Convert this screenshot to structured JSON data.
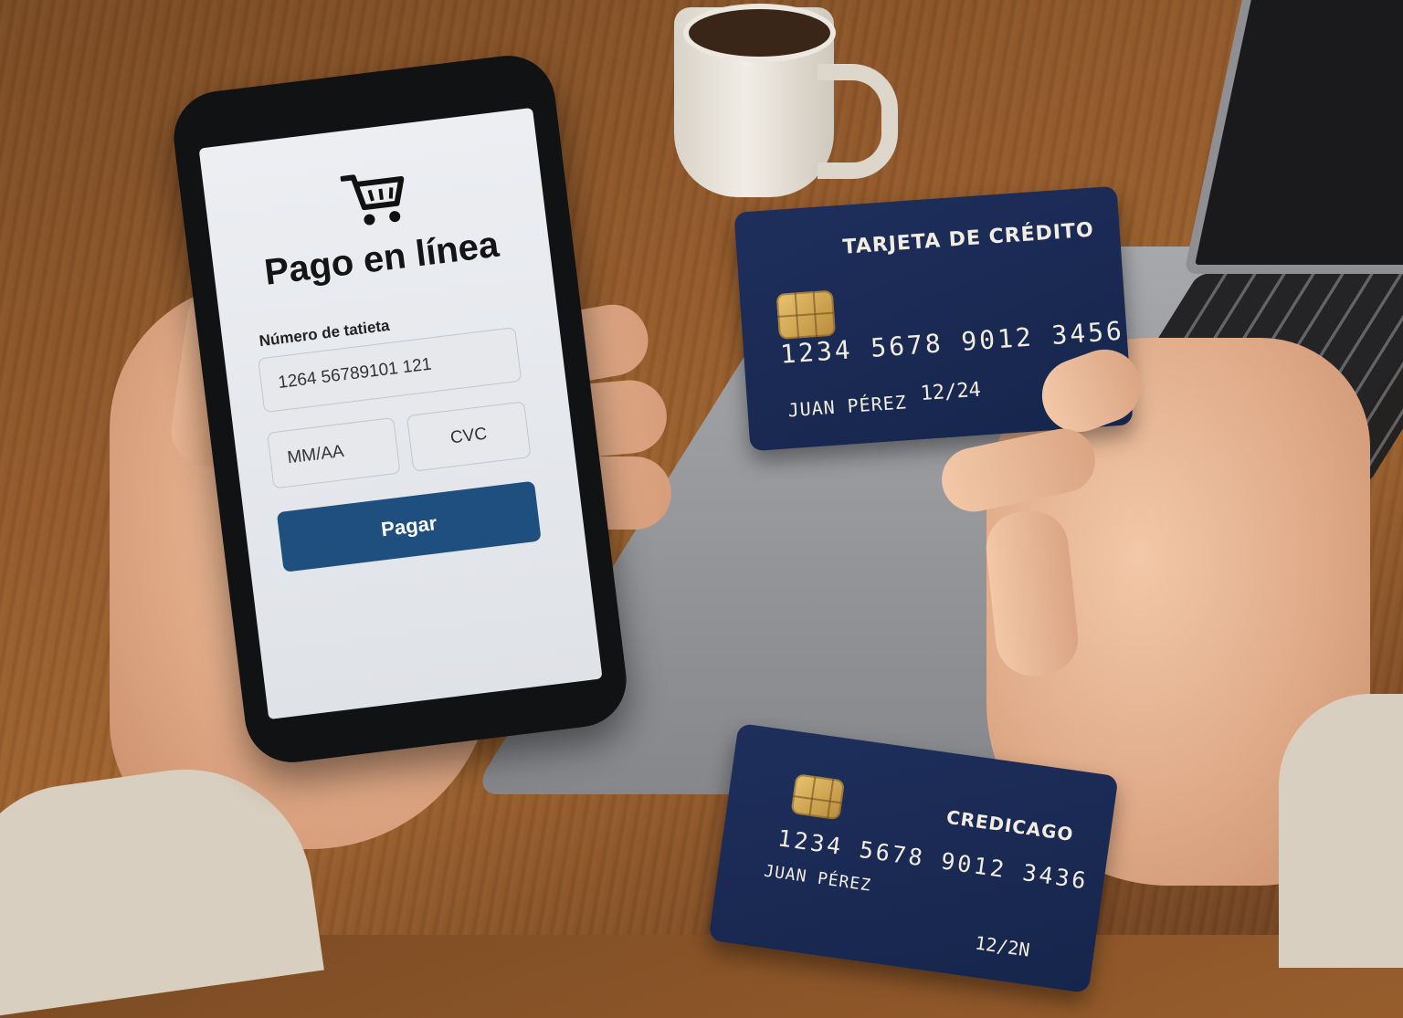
{
  "phone_screen": {
    "icon": "shopping-cart-icon",
    "title": "Pago en línea",
    "card_number_label": "Número de tatieta",
    "card_number_value": "1264 56789101 121",
    "expiry_placeholder": "MM/AA",
    "cvc_placeholder": "CVC",
    "pay_button": "Pagar"
  },
  "credit_card_main": {
    "title": "TARJETA DE CRÉDITO",
    "number": "1234  5678  9012  3456",
    "holder": "JUAN PÉREZ",
    "expiry": "12/24"
  },
  "credit_card_bottom": {
    "brand": "CREDICAGO",
    "number": "1234  5678  9012  3436",
    "holder": "JUAN PÉREZ",
    "expiry": "12/2N"
  },
  "colors": {
    "pay_button": "#1f4f7e",
    "card_navy": "#1e2f5c",
    "chip_gold": "#d4a955"
  }
}
